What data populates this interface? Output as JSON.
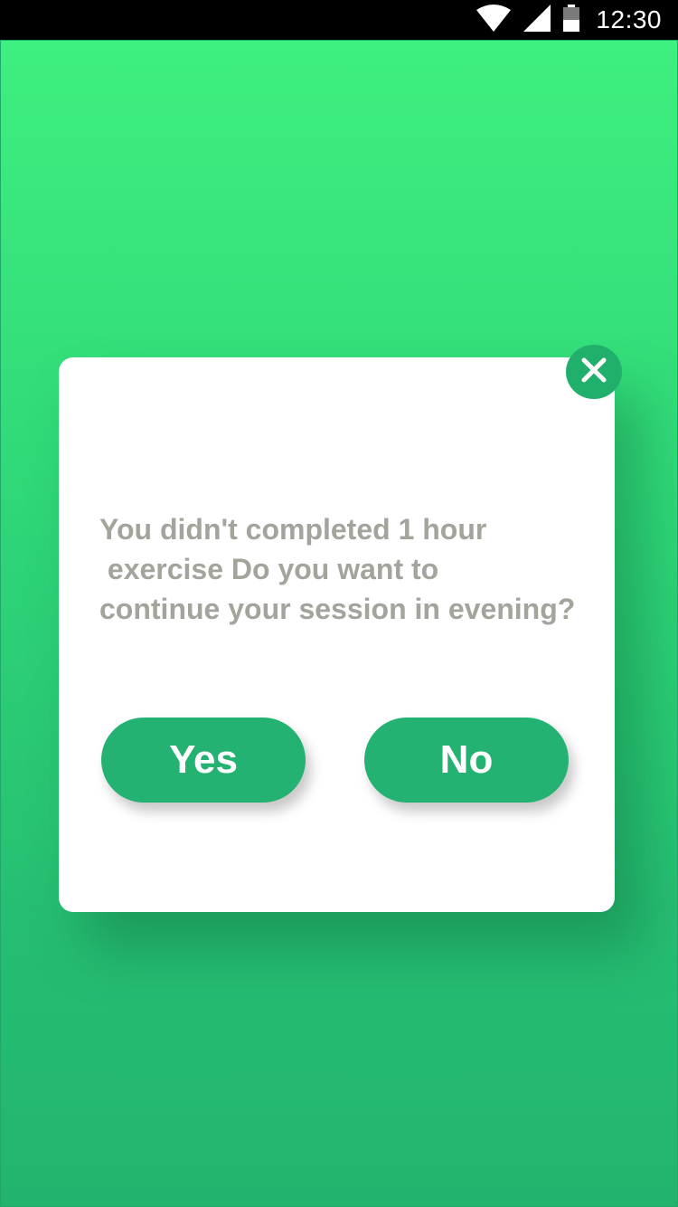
{
  "status_bar": {
    "time": "12:30",
    "icons": [
      "wifi-icon",
      "signal-icon",
      "battery-icon"
    ]
  },
  "dialog": {
    "message": "You didn't completed 1 hour\n exercise Do you want to\ncontinue your session in evening?",
    "yes_label": "Yes",
    "no_label": "No",
    "close_icon": "close-icon"
  },
  "colors": {
    "background_top": "#3ef07f",
    "background_bottom": "#22b46e",
    "accent": "#23b271",
    "message_text": "#a3a49b",
    "dialog_bg": "#ffffff"
  }
}
